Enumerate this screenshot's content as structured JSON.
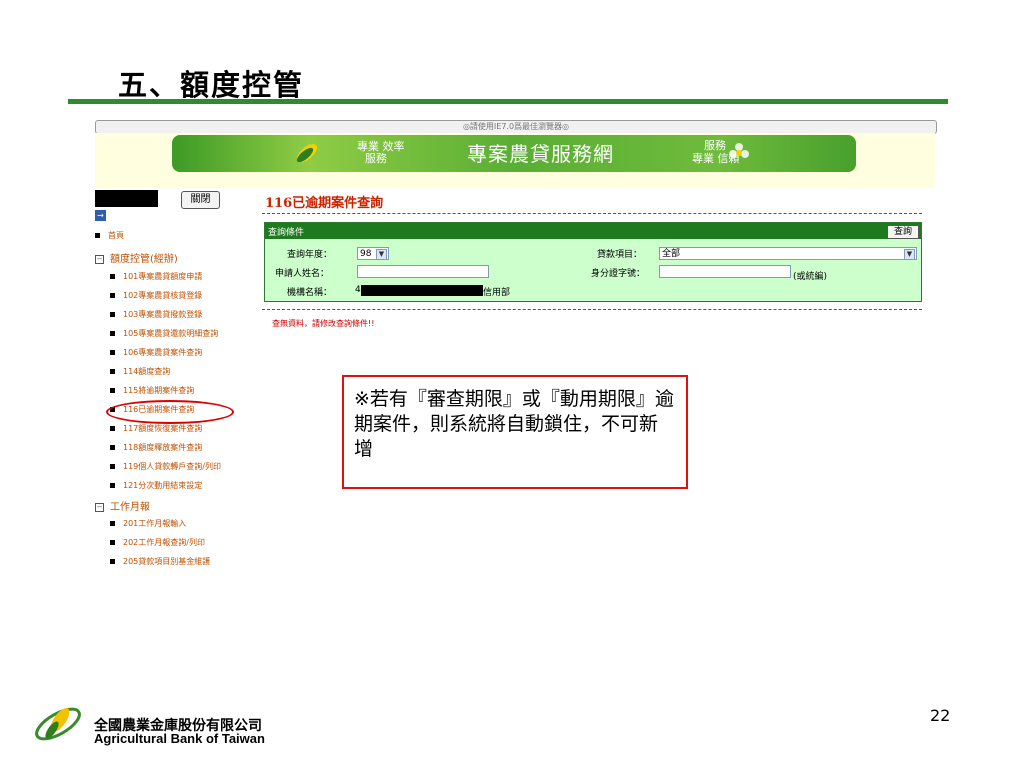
{
  "slide": {
    "title": "五、額度控管",
    "page_number": "22"
  },
  "browser": {
    "notice": "◎請使用IE7.0爲最佳瀏覽器◎"
  },
  "banner": {
    "left_text_1": "專業 效率",
    "left_text_2": "服務",
    "title": "專案農貸服務網",
    "right_text_1": "服務",
    "right_text_2": "專業    信賴"
  },
  "sidebar": {
    "close_label": "關閉",
    "toggle_icon": "→",
    "home": "首頁",
    "group_quota": "額度控管(經辦)",
    "items": [
      "101專案農貸額度申請",
      "102專案農貸核貸登錄",
      "103專案農貸撥款登錄",
      "105專案農貸還款明細查詢",
      "106專案農貸案件查詢",
      "114額度查詢",
      "115將逾期案件查詢",
      "116已逾期案件查詢",
      "117額度恢復案件查詢",
      "118額度釋放案件查詢",
      "119個人貸款轉戶查詢/列印",
      "121分次動用結束設定"
    ],
    "group_monthly": "工作月報",
    "monthly_items": [
      "201工作月報輸入",
      "202工作月報查詢/列印",
      "205貸款項目別基金維護"
    ]
  },
  "query": {
    "heading": "116已逾期案件查詢",
    "panel_title": "查詢條件",
    "query_button": "查詢",
    "year_label": "查詢年度：",
    "year_value": "98",
    "loan_item_label": "貸款項目：",
    "loan_item_value": "全部",
    "applicant_label": "申請人姓名：",
    "applicant_value": "",
    "id_label": "身分證字號：",
    "id_value": "",
    "id_hint": "(或統編)",
    "org_label": "機構名稱：",
    "org_prefix": "4",
    "org_suffix": "信用部",
    "no_data": "查無資料，請修改查詢條件!!"
  },
  "callout": {
    "text": "※若有『審查期限』或『動用期限』逾期案件，則系統將自動鎖住，不可新增"
  },
  "footer": {
    "company_zh": "全國農業金庫股份有限公司",
    "company_en": "Agricultural Bank of Taiwan"
  },
  "colors": {
    "title_rule": "#2e8b2e",
    "panel_bg": "#ccffcc",
    "panel_header": "#1e7a1e",
    "nav_text": "#c05000",
    "heading_red": "#cc2200",
    "callout_border": "#dd1111"
  }
}
